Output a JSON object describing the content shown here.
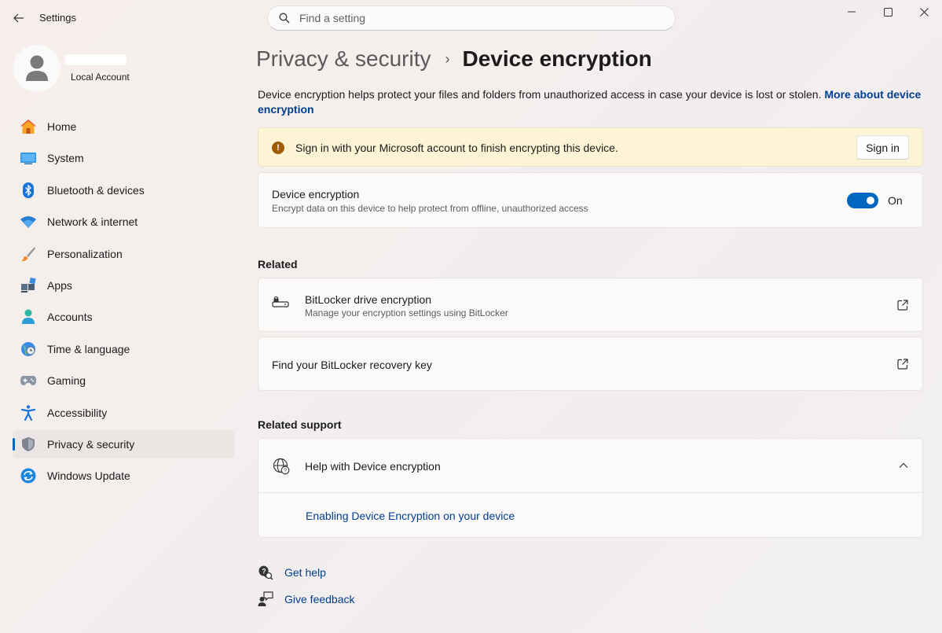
{
  "window": {
    "app_title": "Settings",
    "controls": [
      "minimize-icon",
      "maximize-icon",
      "close-icon"
    ]
  },
  "search": {
    "placeholder": "Find a setting",
    "value": ""
  },
  "profile": {
    "account_type": "Local Account"
  },
  "sidebar": {
    "items": [
      {
        "label": "Home",
        "icon": "home-icon"
      },
      {
        "label": "System",
        "icon": "system-icon"
      },
      {
        "label": "Bluetooth & devices",
        "icon": "bluetooth-icon"
      },
      {
        "label": "Network & internet",
        "icon": "wifi-icon"
      },
      {
        "label": "Personalization",
        "icon": "brush-icon"
      },
      {
        "label": "Apps",
        "icon": "apps-icon"
      },
      {
        "label": "Accounts",
        "icon": "accounts-icon"
      },
      {
        "label": "Time & language",
        "icon": "globe-clock-icon"
      },
      {
        "label": "Gaming",
        "icon": "gamepad-icon"
      },
      {
        "label": "Accessibility",
        "icon": "accessibility-icon"
      },
      {
        "label": "Privacy & security",
        "icon": "shield-icon",
        "active": true
      },
      {
        "label": "Windows Update",
        "icon": "update-icon"
      }
    ]
  },
  "breadcrumb": {
    "parent": "Privacy & security",
    "separator": "›",
    "current": "Device encryption"
  },
  "description": {
    "text": "Device encryption helps protect your files and folders from unauthorized access in case your device is lost or stolen. ",
    "link": "More about device encryption"
  },
  "warning": {
    "icon": "!",
    "text": "Sign in with your Microsoft account to finish encrypting this device.",
    "button": "Sign in"
  },
  "device_encryption": {
    "title": "Device encryption",
    "subtitle": "Encrypt data on this device to help protect from offline, unauthorized access",
    "toggle_state": "On"
  },
  "related": {
    "heading": "Related",
    "items": [
      {
        "title": "BitLocker drive encryption",
        "subtitle": "Manage your encryption settings using BitLocker"
      },
      {
        "title": "Find your BitLocker recovery key",
        "subtitle": ""
      }
    ]
  },
  "related_support": {
    "heading": "Related support",
    "help_title": "Help with Device encryption",
    "help_link": "Enabling Device Encryption on your device"
  },
  "footer": {
    "get_help": "Get help",
    "give_feedback": "Give feedback"
  },
  "colors": {
    "accent": "#0067c0",
    "link": "#003e92",
    "warning_bg": "#fdf3d5"
  }
}
